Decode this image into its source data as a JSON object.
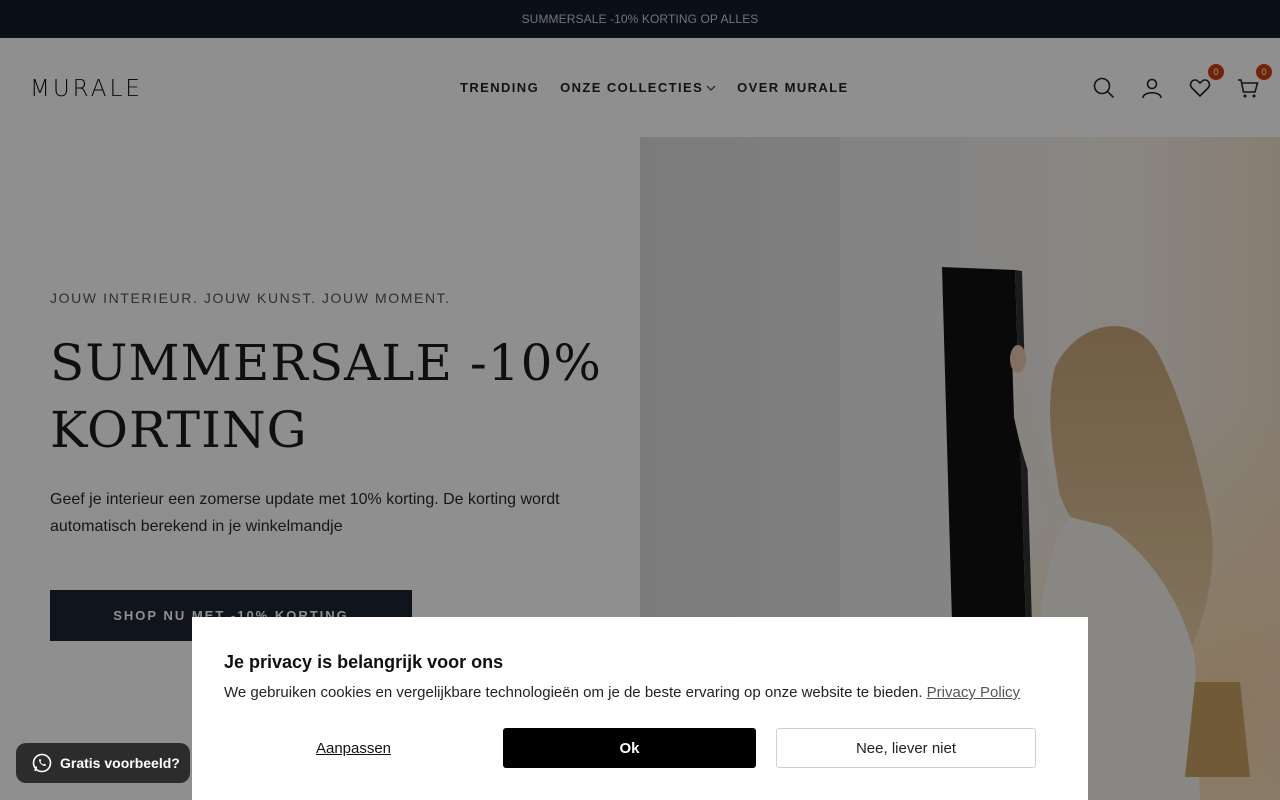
{
  "announcement": {
    "text": "SUMMERSALE -10% KORTING OP ALLES"
  },
  "header": {
    "logo": "MURALE",
    "nav": [
      {
        "label": "TRENDING"
      },
      {
        "label": "ONZE COLLECTIES",
        "has_dropdown": true
      },
      {
        "label": "OVER MURALE"
      }
    ],
    "icons": {
      "search": "search-icon",
      "account": "user-icon",
      "wishlist": "heart-icon",
      "cart": "cart-icon"
    },
    "wishlist_count": "0",
    "cart_count": "0",
    "badge_color": "#c8400a"
  },
  "hero": {
    "eyebrow": "JOUW INTERIEUR. JOUW KUNST. JOUW MOMENT.",
    "headline": "SUMMERSALE -10% KORTING",
    "subtext": "Geef je interieur een zomerse update met 10% korting. De korting wordt automatisch berekend in je winkelmandje",
    "cta_label": "SHOP NU MET -10% KORTING",
    "cta_color": "#1d2434"
  },
  "consent": {
    "title": "Je privacy is belangrijk voor ons",
    "text": "We gebruiken cookies en vergelijkbare technologieën om je de beste ervaring op onze website te bieden.",
    "privacy_link": "Privacy Policy",
    "customize_label": "Aanpassen",
    "ok_label": "Ok",
    "decline_label": "Nee, liever niet"
  },
  "whatsapp": {
    "label": "Gratis voorbeeld?",
    "icon": "whatsapp-icon"
  },
  "colors": {
    "announcement_bg": "#151c2a",
    "accent": "#1d2434"
  }
}
